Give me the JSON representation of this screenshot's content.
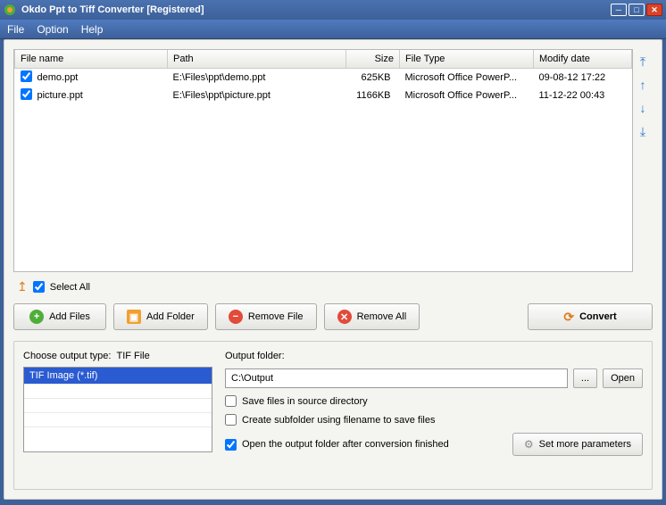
{
  "title": "Okdo Ppt to Tiff Converter [Registered]",
  "menu": {
    "file": "File",
    "option": "Option",
    "help": "Help"
  },
  "columns": {
    "filename": "File name",
    "path": "Path",
    "size": "Size",
    "filetype": "File Type",
    "modify": "Modify date"
  },
  "rows": [
    {
      "checked": true,
      "name": "demo.ppt",
      "path": "E:\\Files\\ppt\\demo.ppt",
      "size": "625KB",
      "type": "Microsoft Office PowerP...",
      "modify": "09-08-12 17:22"
    },
    {
      "checked": true,
      "name": "picture.ppt",
      "path": "E:\\Files\\ppt\\picture.ppt",
      "size": "1166KB",
      "type": "Microsoft Office PowerP...",
      "modify": "11-12-22 00:43"
    }
  ],
  "selectAll": {
    "label": "Select All",
    "checked": true
  },
  "buttons": {
    "addFiles": "Add Files",
    "addFolder": "Add Folder",
    "removeFile": "Remove File",
    "removeAll": "Remove All",
    "convert": "Convert",
    "browse": "...",
    "open": "Open",
    "params": "Set more parameters"
  },
  "output": {
    "chooseTypeLabel": "Choose output type:",
    "currentType": "TIF File",
    "typeOption": "TIF Image (*.tif)",
    "folderLabel": "Output folder:",
    "folderValue": "C:\\Output",
    "saveInSource": {
      "label": "Save files in source directory",
      "checked": false
    },
    "createSubfolder": {
      "label": "Create subfolder using filename to save files",
      "checked": false
    },
    "openAfter": {
      "label": "Open the output folder after conversion finished",
      "checked": true
    }
  }
}
